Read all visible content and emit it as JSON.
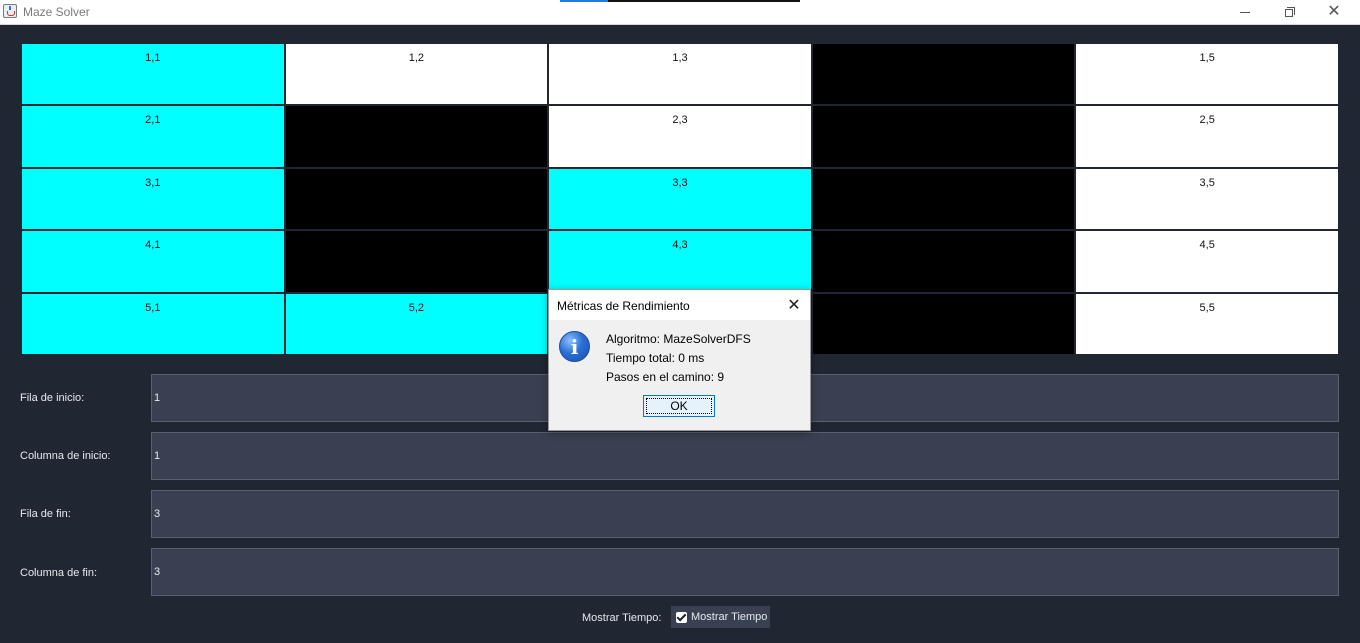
{
  "window": {
    "title": "Maze Solver"
  },
  "maze": {
    "rows": [
      [
        {
          "label": "1,1",
          "state": "path"
        },
        {
          "label": "1,2",
          "state": "open"
        },
        {
          "label": "1,3",
          "state": "open"
        },
        {
          "label": "",
          "state": "wall"
        },
        {
          "label": "1,5",
          "state": "open"
        }
      ],
      [
        {
          "label": "2,1",
          "state": "path"
        },
        {
          "label": "",
          "state": "wall"
        },
        {
          "label": "2,3",
          "state": "open"
        },
        {
          "label": "",
          "state": "wall"
        },
        {
          "label": "2,5",
          "state": "open"
        }
      ],
      [
        {
          "label": "3,1",
          "state": "path"
        },
        {
          "label": "",
          "state": "wall"
        },
        {
          "label": "3,3",
          "state": "path"
        },
        {
          "label": "",
          "state": "wall"
        },
        {
          "label": "3,5",
          "state": "open"
        }
      ],
      [
        {
          "label": "4,1",
          "state": "path"
        },
        {
          "label": "",
          "state": "wall"
        },
        {
          "label": "4,3",
          "state": "path"
        },
        {
          "label": "",
          "state": "wall"
        },
        {
          "label": "4,5",
          "state": "open"
        }
      ],
      [
        {
          "label": "5,1",
          "state": "path"
        },
        {
          "label": "5,2",
          "state": "path"
        },
        {
          "label": "",
          "state": "path"
        },
        {
          "label": "",
          "state": "wall"
        },
        {
          "label": "5,5",
          "state": "open"
        }
      ]
    ],
    "colors": {
      "path": "#00ffff",
      "wall": "#000000",
      "open": "#ffffff"
    }
  },
  "form": {
    "start_row": {
      "label": "Fila de inicio:",
      "value": "1"
    },
    "start_col": {
      "label": "Columna de inicio:",
      "value": "1"
    },
    "end_row": {
      "label": "Fila de fin:",
      "value": "3"
    },
    "end_col": {
      "label": "Columna de fin:",
      "value": "3"
    },
    "show_time": {
      "label": "Mostrar Tiempo:",
      "checkbox_label": "Mostrar Tiempo",
      "checked": true
    }
  },
  "dialog": {
    "title": "Métricas de Rendimiento",
    "icon": "info-icon",
    "lines": [
      "Algoritmo: MazeSolverDFS",
      "Tiempo total: 0 ms",
      "Pasos en el camino: 9"
    ],
    "ok_label": "OK"
  },
  "colors": {
    "background": "#202632",
    "input_background": "#394051",
    "text": "#e6e9ee"
  }
}
